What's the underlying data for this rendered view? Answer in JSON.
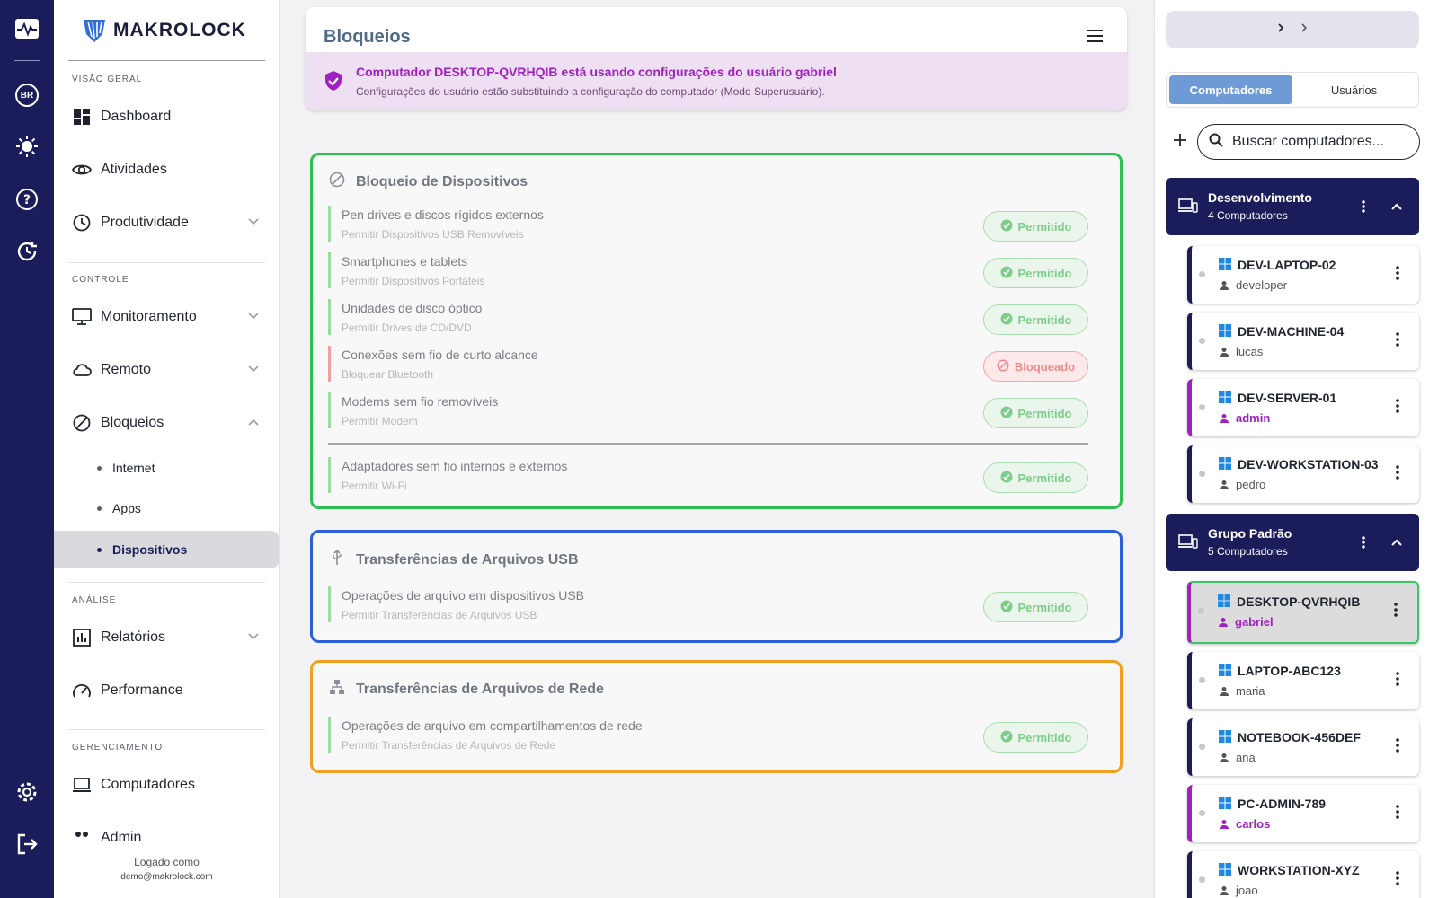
{
  "rail": {
    "lang_badge": "BR"
  },
  "sidebar": {
    "brand": "MAKROLOCK",
    "sections": {
      "overview": "VISÃO GERAL",
      "control": "CONTROLE",
      "analysis": "ANÁLISE",
      "management": "GERENCIAMENTO"
    },
    "items": {
      "dashboard": "Dashboard",
      "activities": "Atividades",
      "productivity": "Produtividade",
      "monitoring": "Monitoramento",
      "remote": "Remoto",
      "blocks": "Bloqueios",
      "internet": "Internet",
      "apps": "Apps",
      "devices": "Dispositivos",
      "reports": "Relatórios",
      "performance": "Performance",
      "computers": "Computadores",
      "admin": "Admin"
    },
    "footer": {
      "logged_as": "Logado como",
      "email": "demo@makrolock.com"
    }
  },
  "main": {
    "title": "Bloqueios",
    "alert": {
      "title": "Computador DESKTOP-QVRHQIB está usando configurações do usuário gabriel",
      "message": "Configurações do usuário estão substituindo a configuração do computador (Modo Superusuário)."
    },
    "devices_card": {
      "title": "Bloqueio de Dispositivos",
      "rows": [
        {
          "name": "Pen drives e discos rígidos externos",
          "desc": "Permitir Dispositivos USB Removíveis",
          "status": "Permitido"
        },
        {
          "name": "Smartphones e tablets",
          "desc": "Permitir Dispositivos Portáteis",
          "status": "Permitido"
        },
        {
          "name": "Unidades de disco óptico",
          "desc": "Permitir Drives de CD/DVD",
          "status": "Permitido"
        },
        {
          "name": "Conexões sem fio de curto alcance",
          "desc": "Bloquear Bluetooth",
          "status": "Bloqueado"
        },
        {
          "name": "Modems sem fio removíveis",
          "desc": "Permitir Modem",
          "status": "Permitido"
        },
        {
          "name": "Adaptadores sem fio internos e externos",
          "desc": "Permitir Wi-Fi",
          "status": "Permitido"
        }
      ]
    },
    "usb_card": {
      "title": "Transferências de Arquivos USB",
      "rows": [
        {
          "name": "Operações de arquivo em dispositivos USB",
          "desc": "Permitir Transferências de Arquivos USB",
          "status": "Permitido"
        }
      ]
    },
    "network_card": {
      "title": "Transferências de Arquivos de Rede",
      "rows": [
        {
          "name": "Operações de arquivo em compartilhamentos de rede",
          "desc": "Permitir Transferências de Arquivos de Rede",
          "status": "Permitido"
        }
      ]
    }
  },
  "right_panel": {
    "tabs": [
      "Computadores",
      "Usuários"
    ],
    "search_placeholder": "Buscar computadores...",
    "groups": [
      {
        "name": "Desenvolvimento",
        "count": "4 Computadores"
      },
      {
        "name": "Grupo Padrão",
        "count": "5 Computadores"
      }
    ],
    "computers": [
      {
        "name": "DEV-LAPTOP-02",
        "user": "developer"
      },
      {
        "name": "DEV-MACHINE-04",
        "user": "lucas"
      },
      {
        "name": "DEV-SERVER-01",
        "user": "admin"
      },
      {
        "name": "DEV-WORKSTATION-03",
        "user": "pedro"
      },
      {
        "name": "DESKTOP-QVRHQIB",
        "user": "gabriel"
      },
      {
        "name": "LAPTOP-ABC123",
        "user": "maria"
      },
      {
        "name": "NOTEBOOK-456DEF",
        "user": "ana"
      },
      {
        "name": "PC-ADMIN-789",
        "user": "carlos"
      },
      {
        "name": "WORKSTATION-XYZ",
        "user": "joao"
      }
    ]
  },
  "colors": {
    "rail": "#1b1d5a",
    "accent_purple": "#a020c0",
    "allowed_green": "#7dcc88",
    "blocked_red": "#f08a8a",
    "card_green": "#2dbf52",
    "card_blue": "#2b5fd9",
    "card_orange": "#f0a020",
    "tab_active": "#6e9bd6"
  }
}
